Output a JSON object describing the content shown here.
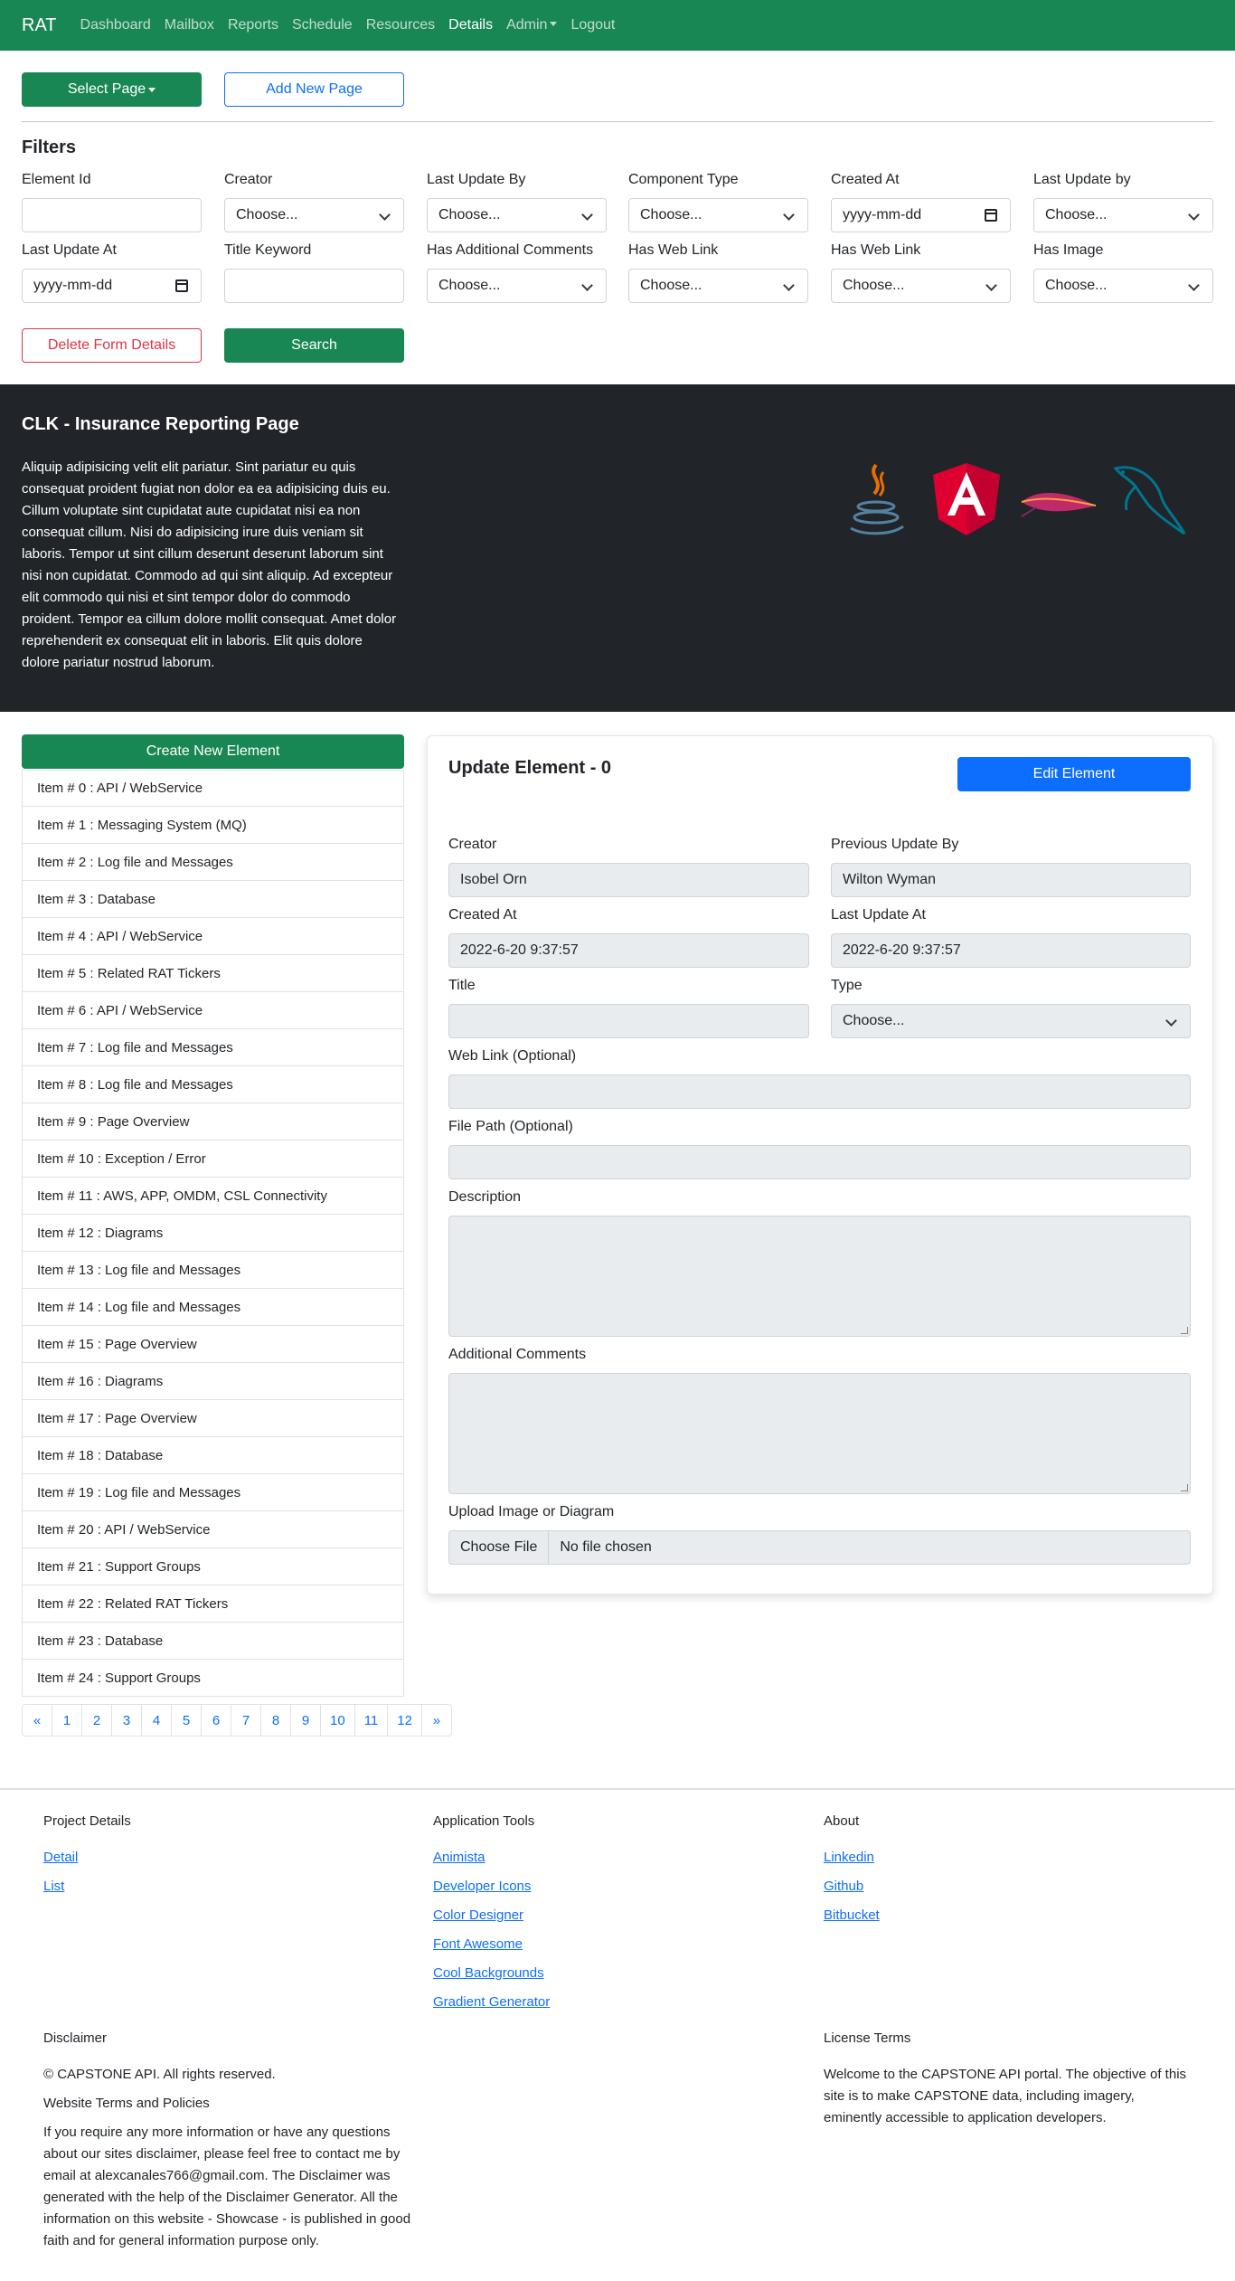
{
  "navbar": {
    "brand": "RAT",
    "links": [
      "Dashboard",
      "Mailbox",
      "Reports",
      "Schedule",
      "Resources",
      "Details",
      "Admin",
      "Logout"
    ],
    "active": "Details"
  },
  "toolbar": {
    "select_page": "Select Page",
    "add_new_page": "Add New Page"
  },
  "filters": {
    "heading": "Filters",
    "row1": [
      {
        "label": "Element Id",
        "kind": "text",
        "value": ""
      },
      {
        "label": "Creator",
        "kind": "select",
        "value": "Choose..."
      },
      {
        "label": "Last Update By",
        "kind": "select",
        "value": "Choose..."
      },
      {
        "label": "Component Type",
        "kind": "select",
        "value": "Choose..."
      },
      {
        "label": "Created At",
        "kind": "date",
        "value": "yyyy-mm-dd"
      },
      {
        "label": "Last Update by",
        "kind": "select",
        "value": "Choose..."
      }
    ],
    "row2": [
      {
        "label": "Last Update At",
        "kind": "date",
        "value": "yyyy-mm-dd"
      },
      {
        "label": "Title Keyword",
        "kind": "text",
        "value": ""
      },
      {
        "label": "Has Additional Comments",
        "kind": "select",
        "value": "Choose..."
      },
      {
        "label": "Has Web Link",
        "kind": "select",
        "value": "Choose..."
      },
      {
        "label": "Has Web Link",
        "kind": "select",
        "value": "Choose..."
      },
      {
        "label": "Has Image",
        "kind": "select",
        "value": "Choose..."
      }
    ],
    "delete_label": "Delete Form Details",
    "search_label": "Search"
  },
  "hero": {
    "title": "CLK - Insurance Reporting Page",
    "text": "Aliquip adipisicing velit elit pariatur. Sint pariatur eu quis consequat proident fugiat non dolor ea ea adipisicing duis eu. Cillum voluptate sint cupidatat aute cupidatat nisi ea non consequat cillum. Nisi do adipisicing irure duis veniam sit laboris. Tempor ut sint cillum deserunt deserunt laborum sint nisi non cupidatat. Commodo ad qui sint aliquip. Ad excepteur elit commodo qui nisi et sint tempor dolor do commodo proident. Tempor ea cillum dolore mollit consequat. Amet dolor reprehenderit ex consequat elit in laboris. Elit quis dolore dolore pariatur nostrud laborum.",
    "logos": [
      "java-logo-icon",
      "angular-logo-icon",
      "apache-feather-logo-icon",
      "mysql-dolphin-logo-icon"
    ]
  },
  "elements": {
    "create_label": "Create New Element",
    "items": [
      "Item # 0 : API / WebService",
      "Item # 1 : Messaging System (MQ)",
      "Item # 2 : Log file and Messages",
      "Item # 3 : Database",
      "Item # 4 : API / WebService",
      "Item # 5 : Related RAT Tickers",
      "Item # 6 : API / WebService",
      "Item # 7 : Log file and Messages",
      "Item # 8 : Log file and Messages",
      "Item # 9 : Page Overview",
      "Item # 10 : Exception / Error",
      "Item # 11 : AWS, APP, OMDM, CSL Connectivity",
      "Item # 12 : Diagrams",
      "Item # 13 : Log file and Messages",
      "Item # 14 : Log file and Messages",
      "Item # 15 : Page Overview",
      "Item # 16 : Diagrams",
      "Item # 17 : Page Overview",
      "Item # 18 : Database",
      "Item # 19 : Log file and Messages",
      "Item # 20 : API / WebService",
      "Item # 21 : Support Groups",
      "Item # 22 : Related RAT Tickers",
      "Item # 23 : Database",
      "Item # 24 : Support Groups"
    ],
    "pages": [
      "«",
      "1",
      "2",
      "3",
      "4",
      "5",
      "6",
      "7",
      "8",
      "9",
      "10",
      "11",
      "12",
      "»"
    ]
  },
  "update_card": {
    "title": "Update Element - 0",
    "edit_label": "Edit Element",
    "creator_label": "Creator",
    "creator_value": "Isobel Orn",
    "previous_update_label": "Previous Update By",
    "previous_update_value": "Wilton Wyman",
    "created_at_label": "Created At",
    "created_at_value": "2022-6-20 9:37:57",
    "last_update_label": "Last Update At",
    "last_update_value": "2022-6-20 9:37:57",
    "title_label": "Title",
    "title_value": "",
    "type_label": "Type",
    "type_value": "Choose...",
    "web_link_label": "Web Link (Optional)",
    "file_path_label": "File Path (Optional)",
    "description_label": "Description",
    "comments_label": "Additional Comments",
    "upload_label": "Upload Image or Diagram",
    "choose_file": "Choose File",
    "no_file": "No file chosen"
  },
  "footer": {
    "project_heading": "Project Details",
    "project_links": [
      "Detail",
      "List"
    ],
    "tools_heading": "Application Tools",
    "tools_links": [
      "Animista",
      "Developer Icons",
      "Color Designer",
      "Font Awesome",
      "Cool Backgrounds",
      "Gradient Generator"
    ],
    "about_heading": "About",
    "about_links": [
      "Linkedin",
      "Github",
      "Bitbucket"
    ],
    "disclaimer_heading": "Disclaimer",
    "copyright": "© CAPSTONE API. All rights reserved.",
    "terms_heading": "Website Terms and Policies",
    "disclaimer_text": "If you require any more information or have any questions about our sites disclaimer, please feel free to contact me by email at alexcanales766@gmail.com. The Disclaimer was generated with the help of the Disclaimer Generator. All the information on this website - Showcase - is published in good faith and for general information purpose only.",
    "license_heading": "License Terms",
    "license_text": "Welcome to the CAPSTONE API portal. The objective of this site is to make CAPSTONE data, including imagery, eminently accessible to application developers."
  }
}
